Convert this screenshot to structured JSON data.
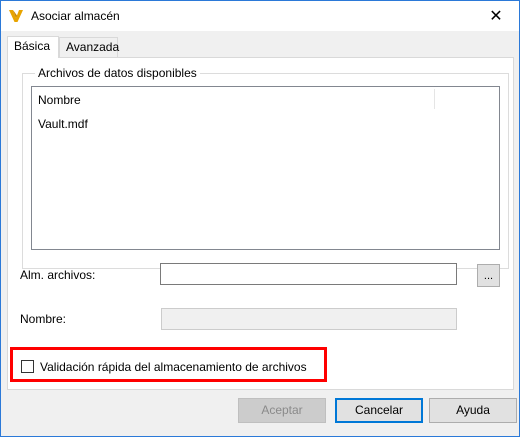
{
  "window": {
    "title": "Asociar almacén",
    "close_glyph": "✕"
  },
  "tabs": [
    {
      "label": "Básica"
    },
    {
      "label": "Avanzada"
    }
  ],
  "group": {
    "title": "Archivos de datos disponibles",
    "column_header": "Nombre",
    "rows": [
      "Vault.mdf"
    ]
  },
  "fields": {
    "alm_label": "Alm. archivos:",
    "alm_value": "",
    "browse_label": "...",
    "nombre_label": "Nombre:",
    "nombre_value": ""
  },
  "checkbox": {
    "label": "Validación rápida del almacenamiento de archivos",
    "checked": false
  },
  "buttons": {
    "accept": "Aceptar",
    "cancel": "Cancelar",
    "help": "Ayuda"
  },
  "colors": {
    "highlight": "#ff0000",
    "app_icon": "#e8a400",
    "accent": "#0078d7"
  }
}
